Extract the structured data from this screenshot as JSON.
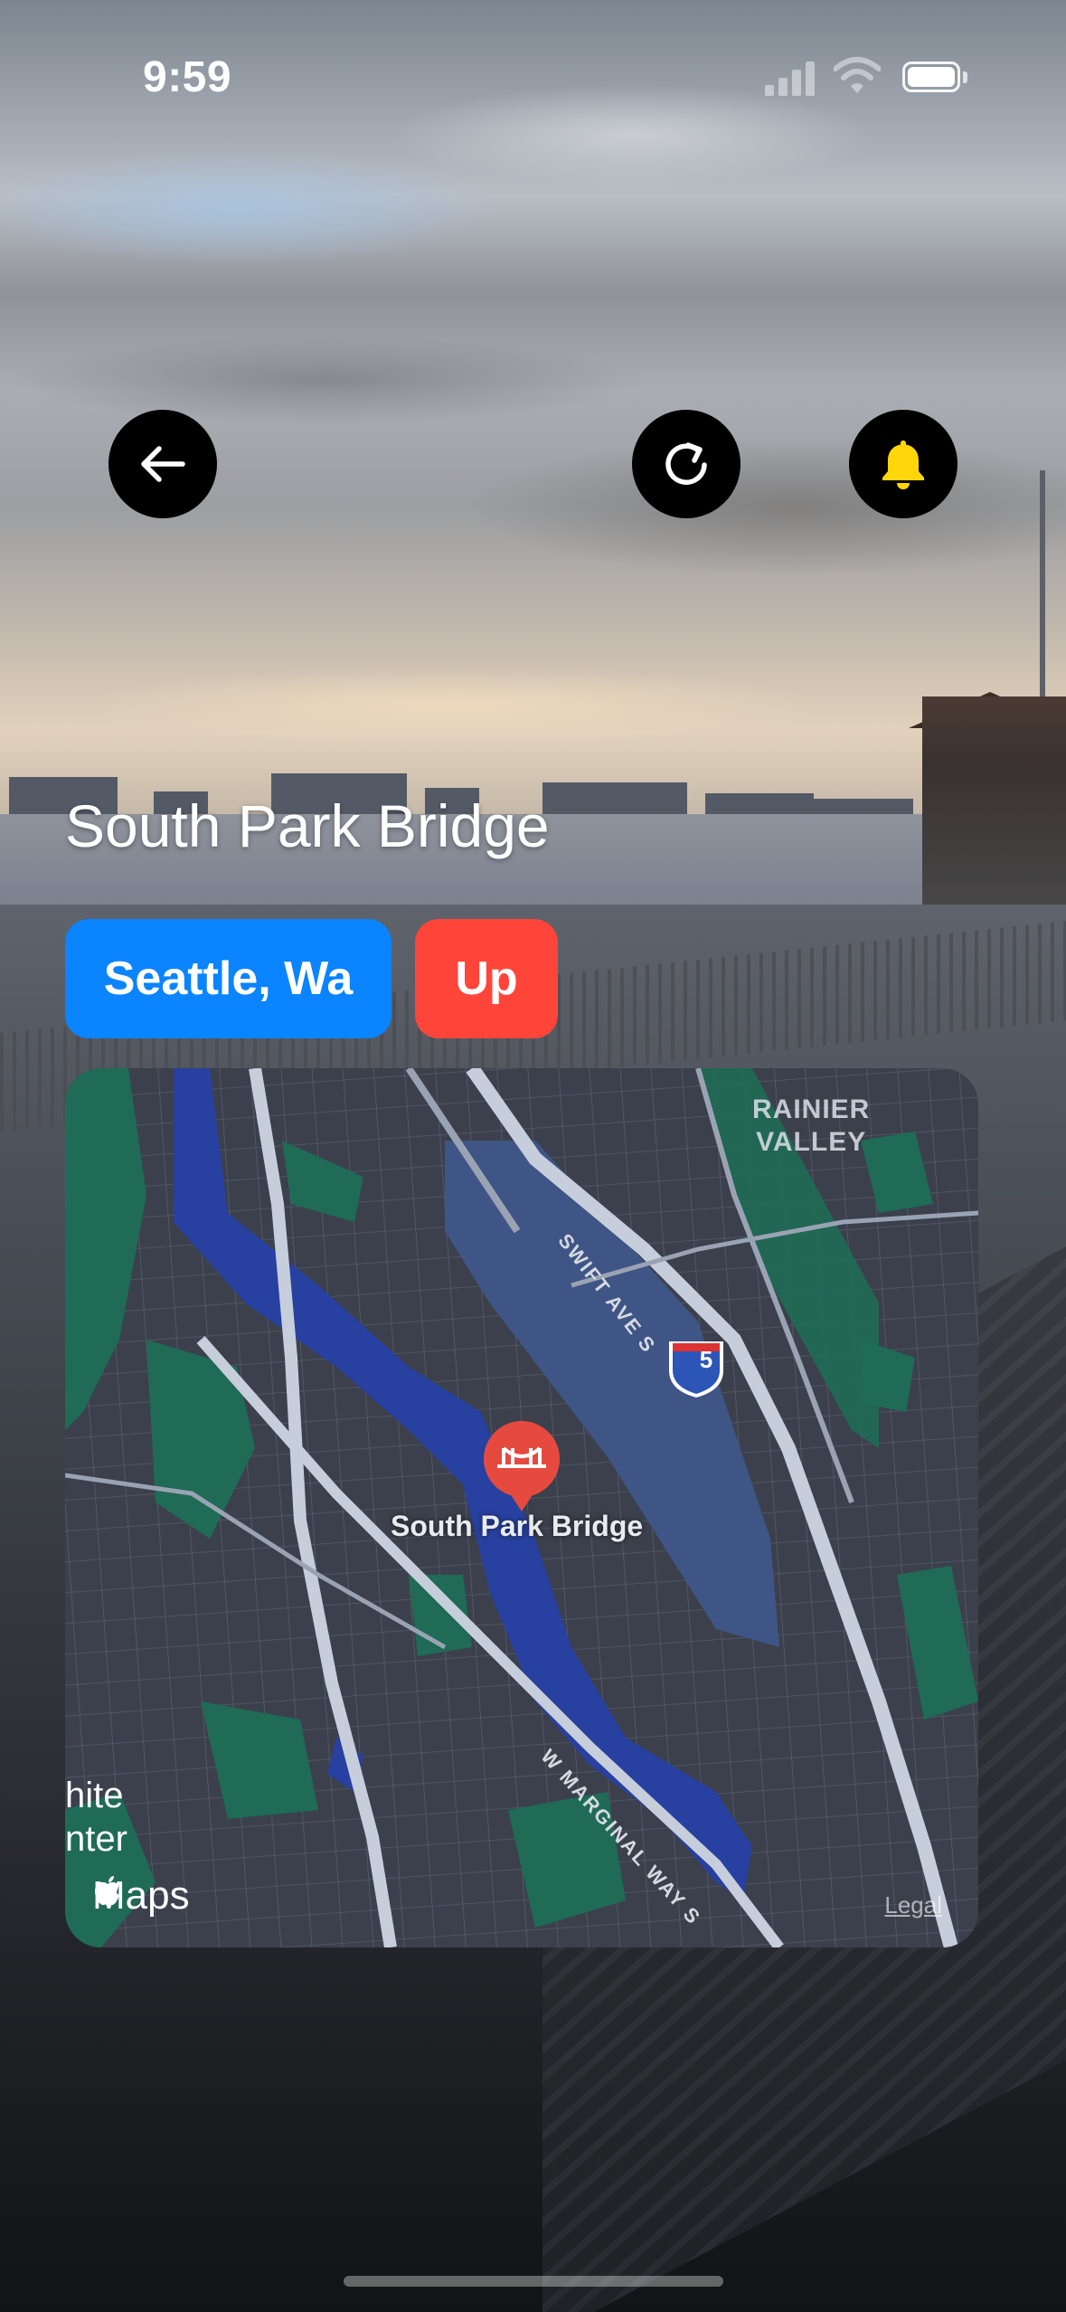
{
  "status_bar": {
    "time": "9:59"
  },
  "nav": {
    "back_icon": "arrow-left-icon",
    "refresh_icon": "refresh-icon",
    "bell_icon": "bell-icon",
    "bell_color": "#ffd60a"
  },
  "bridge": {
    "name": "South Park Bridge",
    "city": "Seattle, Wa",
    "status": "Up",
    "city_color": "#0a84ff",
    "status_color": "#ff453a"
  },
  "map": {
    "area_label_1": "RAINIER",
    "area_label_2": "VALLEY",
    "street_1": "SWIFT AVE S",
    "street_2": "W MARGINAL WAY S",
    "highway_shield": "5",
    "pin_label": "South Park Bridge",
    "edge_label_1": "hite",
    "edge_label_2": "nter",
    "attribution": "Maps",
    "legal": "Legal"
  }
}
